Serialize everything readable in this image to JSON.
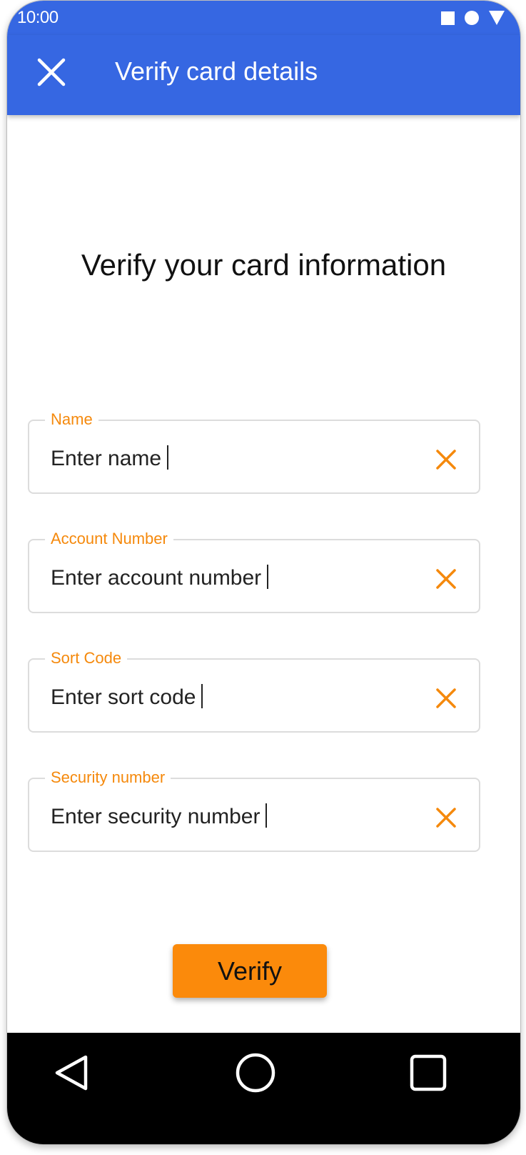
{
  "status_bar": {
    "time": "10:00",
    "icons": [
      "square-icon",
      "circle-icon",
      "triangle-icon"
    ]
  },
  "app_bar": {
    "title": "Verify card details",
    "close_icon": "close-icon"
  },
  "heading": "Verify your card information",
  "fields": [
    {
      "label": "Name",
      "value": "Enter name"
    },
    {
      "label": "Account Number",
      "value": "Enter account number"
    },
    {
      "label": "Sort Code",
      "value": "Enter sort code"
    },
    {
      "label": "Security number",
      "value": "Enter security number"
    }
  ],
  "verify_button": {
    "label": "Verify"
  },
  "nav_bar": {
    "icons": [
      "back-triangle-icon",
      "home-circle-icon",
      "recents-square-icon"
    ]
  },
  "colors": {
    "primary": "#3667e2",
    "accent": "#fb8a0b",
    "label_accent": "#f5890c",
    "nav_background": "#000000"
  }
}
